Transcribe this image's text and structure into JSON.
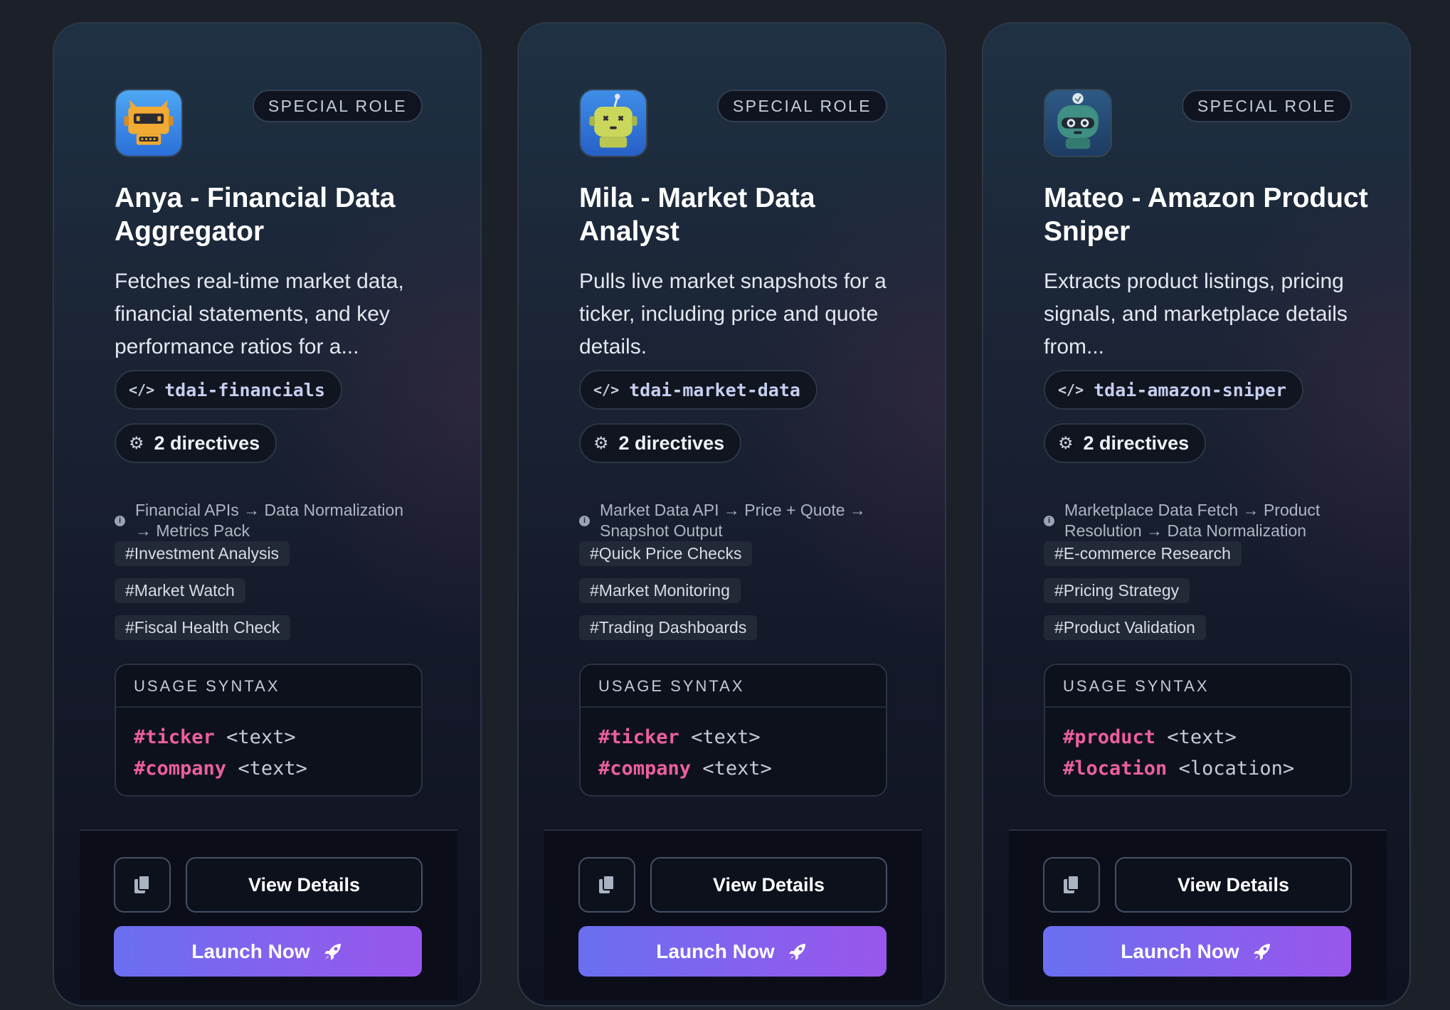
{
  "cards": [
    {
      "avatar": "orange-robot-avatar",
      "badge": "SPECIAL ROLE",
      "title": "Anya - Financial Data Aggregator",
      "description": "Fetches real-time market data, financial statements, and key performance ratios for a...",
      "code": "tdai-financials",
      "directives": "2 directives",
      "flow": "Financial APIs → Data Normalization → Metrics Pack",
      "tags": [
        "#Investment Analysis",
        "#Market Watch",
        "#Fiscal Health Check"
      ],
      "usage_label": "USAGE SYNTAX",
      "usage": [
        {
          "kw": "#ticker",
          "arg": "<text>"
        },
        {
          "kw": "#company",
          "arg": "<text>"
        }
      ],
      "details_label": "View Details",
      "launch_label": "Launch Now"
    },
    {
      "avatar": "green-robot-avatar",
      "badge": "SPECIAL ROLE",
      "title": "Mila - Market Data Analyst",
      "description": "Pulls live market snapshots for a ticker, including price and quote details.",
      "code": "tdai-market-data",
      "directives": "2 directives",
      "flow": "Market Data API → Price + Quote → Snapshot Output",
      "tags": [
        "#Quick Price Checks",
        "#Market Monitoring",
        "#Trading Dashboards"
      ],
      "usage_label": "USAGE SYNTAX",
      "usage": [
        {
          "kw": "#ticker",
          "arg": "<text>"
        },
        {
          "kw": "#company",
          "arg": "<text>"
        }
      ],
      "details_label": "View Details",
      "launch_label": "Launch Now"
    },
    {
      "avatar": "teal-robot-avatar",
      "badge": "SPECIAL ROLE",
      "title": "Mateo - Amazon Product Sniper",
      "description": "Extracts product listings, pricing signals, and marketplace details from...",
      "code": "tdai-amazon-sniper",
      "directives": "2 directives",
      "flow": "Marketplace Data Fetch → Product Resolution → Data Normalization",
      "tags": [
        "#E-commerce Research",
        "#Pricing Strategy",
        "#Product Validation"
      ],
      "usage_label": "USAGE SYNTAX",
      "usage": [
        {
          "kw": "#product",
          "arg": "<text>"
        },
        {
          "kw": "#location",
          "arg": "<location>"
        }
      ],
      "details_label": "View Details",
      "launch_label": "Launch Now"
    }
  ],
  "icons": {
    "code": "code-icon",
    "directives": "gears-icon",
    "info": "info-icon",
    "copy": "copy-icon",
    "launch": "rocket-icon"
  },
  "colors": {
    "keyword": "#ec5f9f",
    "launch_start": "#6a6ff0",
    "launch_end": "#9a56ec"
  }
}
